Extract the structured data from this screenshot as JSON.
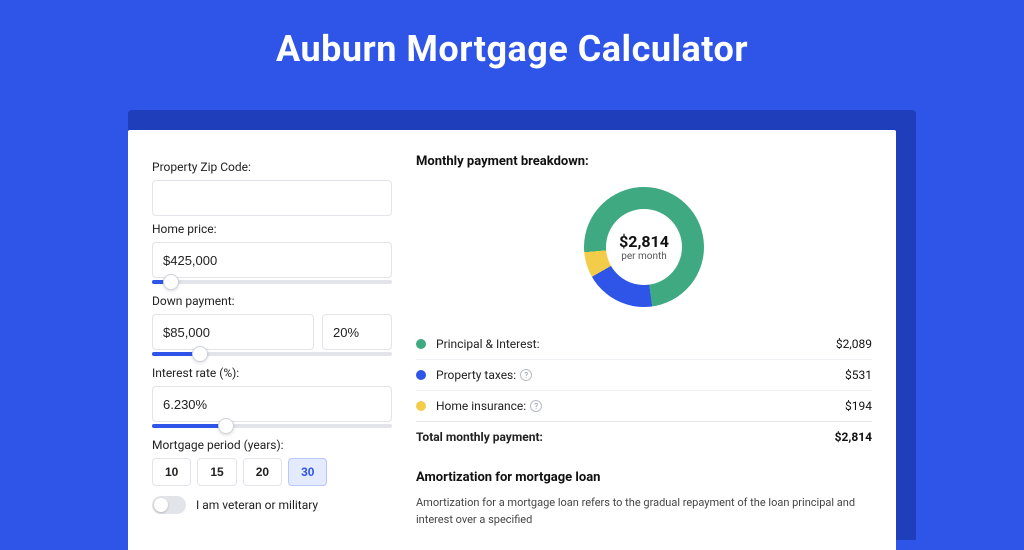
{
  "page_title": "Auburn Mortgage Calculator",
  "form": {
    "zip_label": "Property Zip Code:",
    "zip_value": "",
    "home_price_label": "Home price:",
    "home_price_value": "$425,000",
    "home_price_slider_pct": 8,
    "down_payment_label": "Down payment:",
    "down_payment_value": "$85,000",
    "down_payment_pct_value": "20%",
    "down_payment_slider_pct": 20,
    "interest_label": "Interest rate (%):",
    "interest_value": "6.230%",
    "interest_slider_pct": 31,
    "period_label": "Mortgage period (years):",
    "period_options": [
      {
        "label": "10",
        "active": false
      },
      {
        "label": "15",
        "active": false
      },
      {
        "label": "20",
        "active": false
      },
      {
        "label": "30",
        "active": true
      }
    ],
    "veteran_label": "I am veteran or military",
    "veteran_on": false
  },
  "breakdown": {
    "title": "Monthly payment breakdown:",
    "center_amount": "$2,814",
    "center_sub": "per month",
    "items": [
      {
        "label": "Principal & Interest:",
        "value": "$2,089",
        "color": "#3fa981",
        "info": false
      },
      {
        "label": "Property taxes:",
        "value": "$531",
        "color": "#2f55e8",
        "info": true
      },
      {
        "label": "Home insurance:",
        "value": "$194",
        "color": "#f3cd4a",
        "info": true
      }
    ],
    "total_label": "Total monthly payment:",
    "total_value": "$2,814"
  },
  "chart_data": {
    "type": "pie",
    "title": "Monthly payment breakdown",
    "series": [
      {
        "name": "Principal & Interest",
        "value": 2089,
        "color": "#3fa981"
      },
      {
        "name": "Property taxes",
        "value": 531,
        "color": "#2f55e8"
      },
      {
        "name": "Home insurance",
        "value": 194,
        "color": "#f3cd4a"
      }
    ],
    "total": 2814,
    "unit": "USD per month"
  },
  "amortization": {
    "title": "Amortization for mortgage loan",
    "text": "Amortization for a mortgage loan refers to the gradual repayment of the loan principal and interest over a specified"
  }
}
